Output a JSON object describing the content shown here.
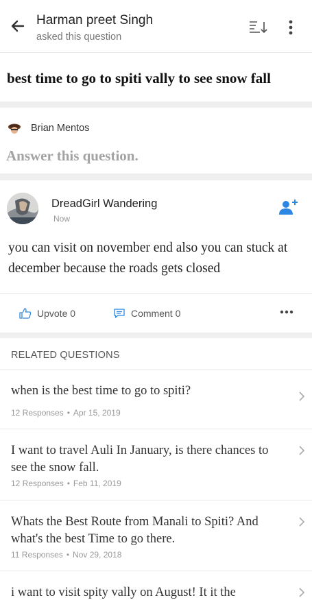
{
  "header": {
    "asker_name": "Harman preet Singh",
    "asker_subtitle": "asked this question"
  },
  "question": {
    "title": "best time to go to spiti vally to see snow fall"
  },
  "answer_prompt": {
    "user_name": "Brian Mentos",
    "prompt": "Answer this question."
  },
  "answer": {
    "author": "DreadGirl Wandering",
    "time": "Now",
    "body": "you can visit on november end also you can stuck at december because the roads gets closed",
    "upvote_label": "Upvote 0",
    "comment_label": "Comment 0"
  },
  "related": {
    "heading": "RELATED QUESTIONS",
    "items": [
      {
        "title": "when is the best time to go to spiti?",
        "responses": "12 Responses",
        "date": "Apr 15, 2019"
      },
      {
        "title": "I want to travel Auli In January, is there chances to see the snow fall.",
        "responses": "12 Responses",
        "date": "Feb 11, 2019"
      },
      {
        "title": "Whats the Best Route from Manali to Spiti? And what's the best Time to go there.",
        "responses": "11 Responses",
        "date": "Nov 29, 2018"
      },
      {
        "title": "i want to visit spity vally on August! It it the",
        "responses": "",
        "date": ""
      }
    ]
  },
  "colors": {
    "accent": "#2b87e3",
    "separator": "#efefef",
    "muted_text": "#999999"
  }
}
